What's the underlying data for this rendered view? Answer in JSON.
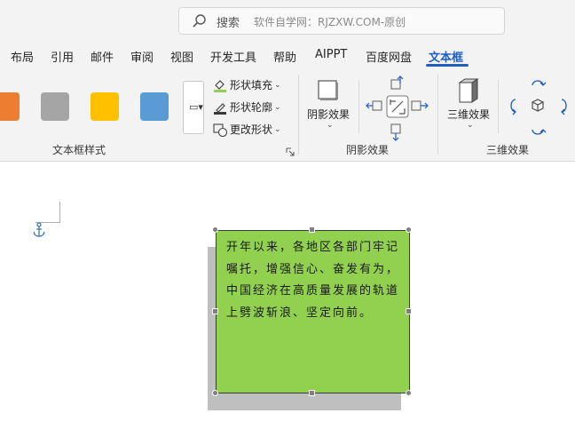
{
  "search": {
    "label": "搜索",
    "hint": "软件自学网：RJZXW.COM-原创"
  },
  "tabs": [
    {
      "label": "布局"
    },
    {
      "label": "引用"
    },
    {
      "label": "邮件"
    },
    {
      "label": "审阅"
    },
    {
      "label": "视图"
    },
    {
      "label": "开发工具"
    },
    {
      "label": "帮助"
    },
    {
      "label": "AIPPT"
    },
    {
      "label": "百度网盘"
    },
    {
      "label": "文本框"
    }
  ],
  "ribbon": {
    "swatches": [
      {
        "name": "orange",
        "color": "#ed7d31"
      },
      {
        "name": "gray",
        "color": "#a5a5a5"
      },
      {
        "name": "gold",
        "color": "#ffc000"
      },
      {
        "name": "blue",
        "color": "#5b9bd5"
      }
    ],
    "shape_fill": "形状填充",
    "shape_outline": "形状轮廓",
    "change_shape": "更改形状",
    "textbox_styles_label": "文本框样式",
    "shadow_effects_button": "阴影效果",
    "shadow_effects_label": "阴影效果",
    "three_d_button": "三维效果",
    "three_d_label": "三维效果"
  },
  "document": {
    "textbox_text": "开年以来，各地区各部门牢记嘱托，增强信心、奋发有为，中国经济在高质量发展的轨道上劈波斩浪、坚定向前。",
    "textbox_fill": "#92d050",
    "shadow_color": "#bfbfbf"
  },
  "colors": {
    "accent": "#1f5fbf"
  }
}
